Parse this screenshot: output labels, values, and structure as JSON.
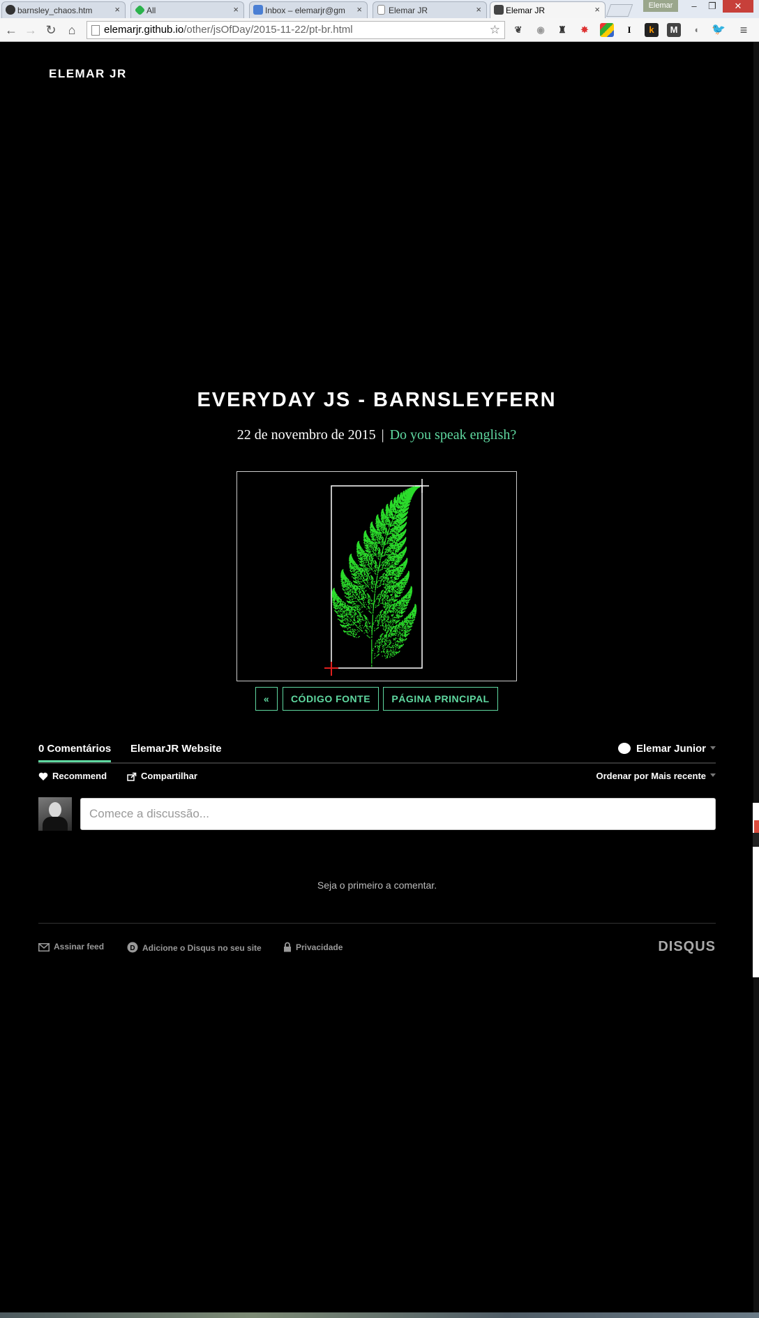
{
  "browser": {
    "tabs": [
      {
        "title": "barnsley_chaos.htm",
        "favicon": "github-icon",
        "active": false
      },
      {
        "title": "All",
        "favicon": "feedly-icon",
        "active": false
      },
      {
        "title": "Inbox – elemarjr@gm",
        "favicon": "inbox-icon",
        "active": false
      },
      {
        "title": "Elemar JR",
        "favicon": "page-icon",
        "active": false
      },
      {
        "title": "Elemar JR",
        "favicon": "avatar-icon",
        "active": true
      }
    ],
    "profile_name": "Elemar",
    "url_host": "elemarjr.github.io",
    "url_path": "/other/jsOfDay/2015-11-22/pt-br.html"
  },
  "site": {
    "brand": "ELEMAR JR"
  },
  "post": {
    "title": "EVERYDAY JS - BARNSLEYFERN",
    "date": "22 de novembro de 2015",
    "separator": "|",
    "lang_link": "Do you speak english?",
    "fern_color": "#2bdc2b"
  },
  "post_nav": {
    "prev_label": "«",
    "source_label": "CÓDIGO FONTE",
    "home_label": "PÁGINA PRINCIPAL"
  },
  "disqus": {
    "tab_comments": "0 Comentários",
    "tab_site": "ElemarJR Website",
    "user_name": "Elemar Junior",
    "recommend": "Recommend",
    "share": "Compartilhar",
    "sort_label": "Ordenar por Mais recente",
    "input_placeholder": "Comece a discussão...",
    "empty_message": "Seja o primeiro a comentar.",
    "footer": {
      "feed": "Assinar feed",
      "add": "Adicione o Disqus no seu site",
      "privacy": "Privacidade",
      "logo": "DISQUS"
    }
  },
  "colors": {
    "accent": "#5fd8a0",
    "background": "#000000"
  }
}
